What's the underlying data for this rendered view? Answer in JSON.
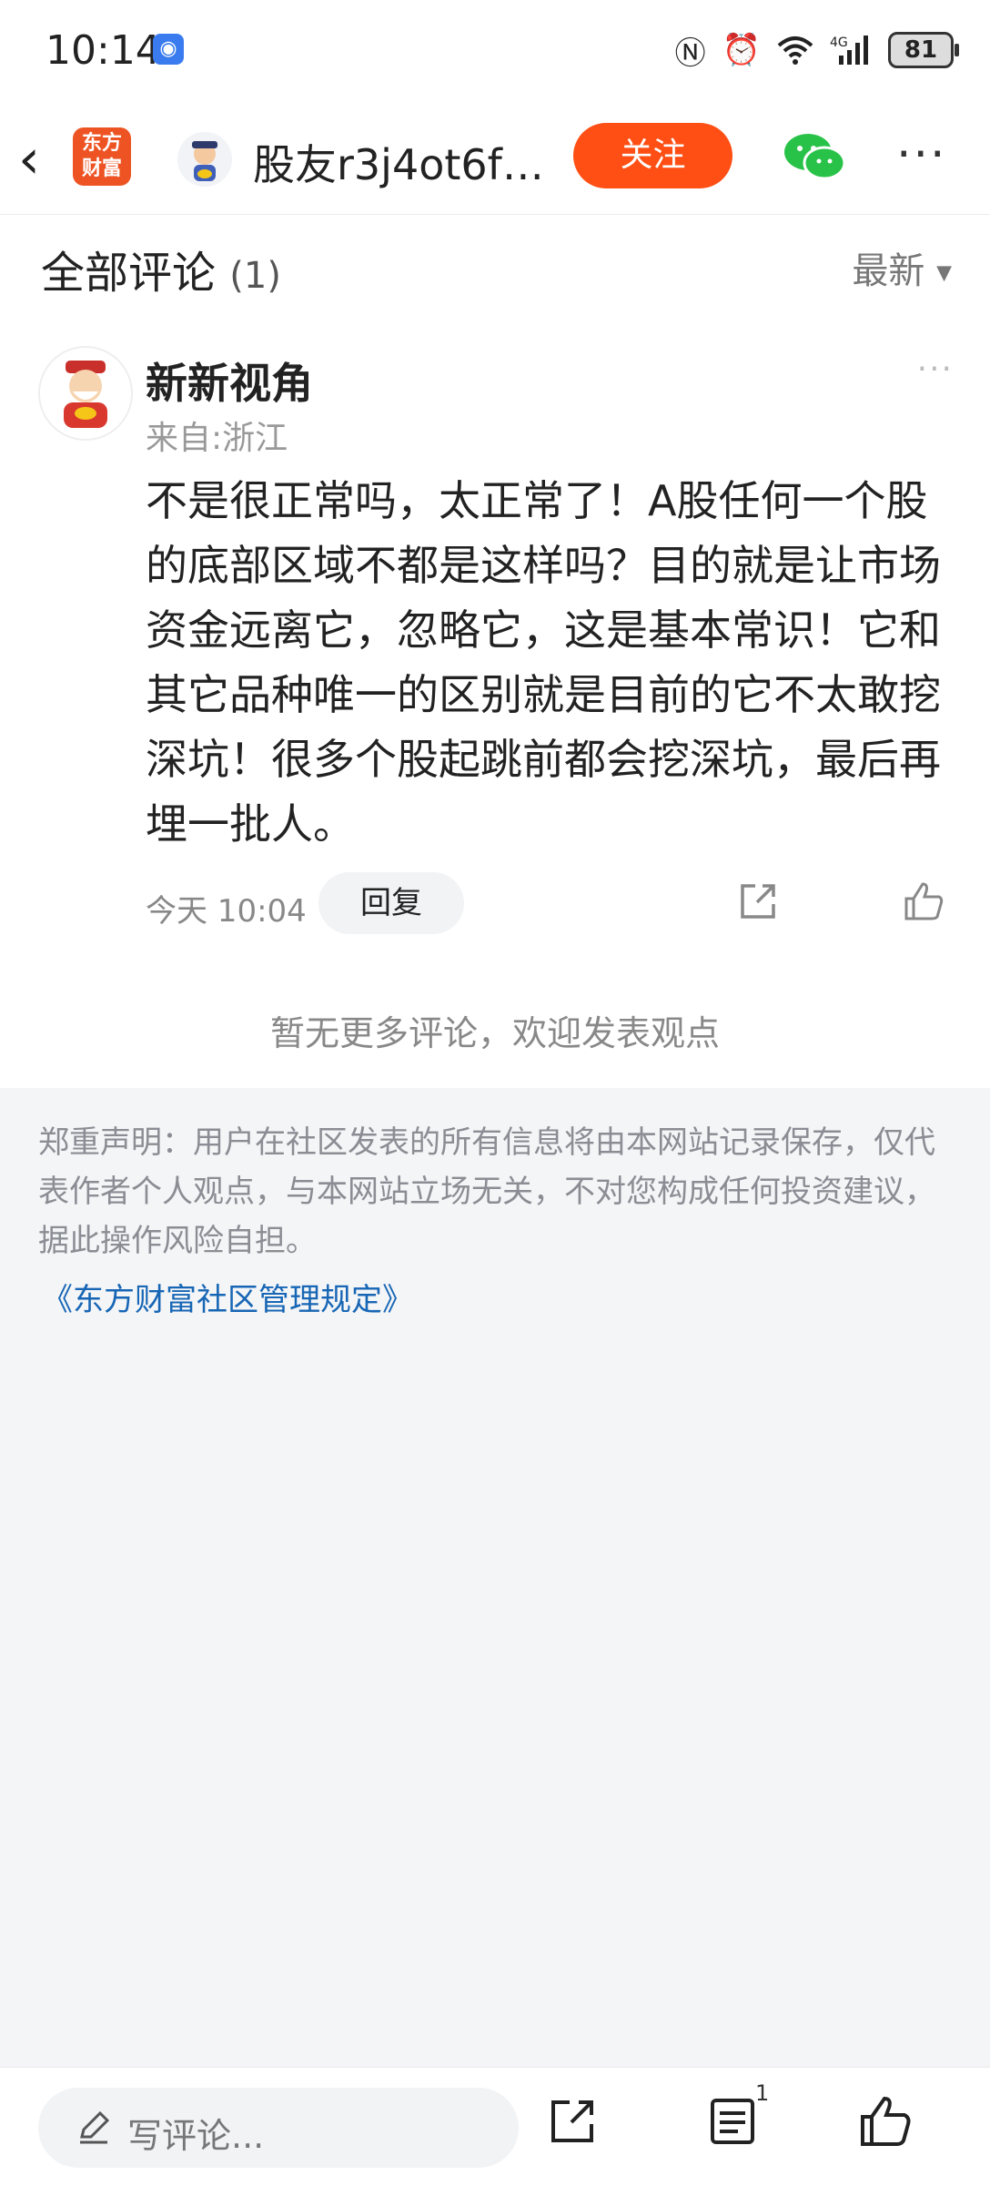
{
  "status_bar": {
    "time": "10:14",
    "battery": "81",
    "icons": [
      "nfc-icon",
      "alarm-icon",
      "wifi-icon",
      "signal-4g-icon"
    ]
  },
  "header": {
    "back_icon": "chevron-left-icon",
    "logo_text_line1": "东方",
    "logo_text_line2": "财富",
    "title": "股友r3j4ot6f…",
    "follow_label": "关注",
    "more_icon": "more-dots-icon"
  },
  "comments_section": {
    "title": "全部评论",
    "count": "(1)",
    "sort_label": "最新"
  },
  "comment": {
    "username": "新新视角",
    "location": "来自:浙江",
    "body": "不是很正常吗，太正常了！A股任何一个股的底部区域不都是这样吗？目的就是让市场资金远离它，忽略它，这是基本常识！它和其它品种唯一的区别就是目前的它不太敢挖深坑！很多个股起跳前都会挖深坑，最后再埋一批人。",
    "timestamp": "今天 10:04",
    "reply_label": "回复"
  },
  "no_more_text": "暂无更多评论，欢迎发表观点",
  "disclaimer": {
    "text": "郑重声明：用户在社区发表的所有信息将由本网站记录保存，仅代表作者个人观点，与本网站立场无关，不对您构成任何投资建议，据此操作风险自担。",
    "link_text": "《东方财富社区管理规定》"
  },
  "bottom_bar": {
    "input_placeholder": "写评论...",
    "comment_count": "1"
  },
  "colors": {
    "accent": "#ff4f14",
    "link": "#1766b5",
    "wechat": "#29c248"
  }
}
